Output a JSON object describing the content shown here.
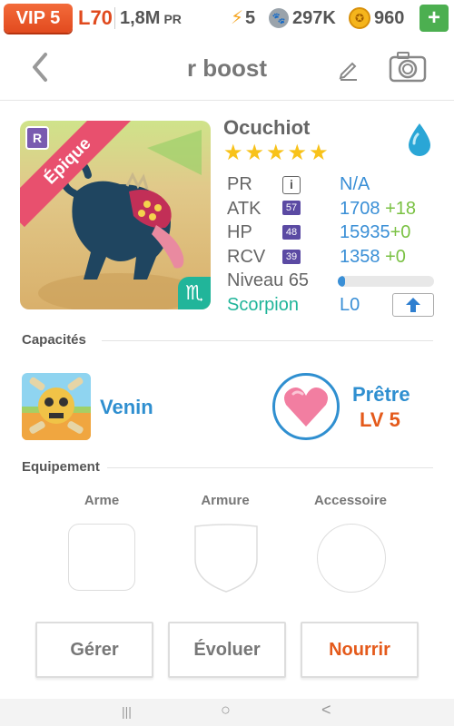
{
  "topbar": {
    "vip": "VIP 5",
    "level": "L70",
    "power": "1,8M",
    "power_unit": "PR",
    "energy": "5",
    "paws": "297K",
    "coins": "960",
    "add": "+"
  },
  "header": {
    "title": "r boost",
    "icons": [
      "back-arrow-icon",
      "edit-pencil-icon",
      "camera-icon"
    ]
  },
  "monster": {
    "rarity": "Épique",
    "rank_badge": "R",
    "name": "Ocuchiot",
    "stars": "★★★★★",
    "element": "water",
    "stats": [
      {
        "label": "PR",
        "badge": "i",
        "value": "N/A",
        "plus": ""
      },
      {
        "label": "ATK",
        "badge": "57",
        "value": "1708",
        "plus": "+18"
      },
      {
        "label": "HP",
        "badge": "48",
        "value": "15935",
        "plus": "+0"
      },
      {
        "label": "RCV",
        "badge": "39",
        "value": "1358",
        "plus": "+0"
      }
    ],
    "level_label": "Niveau 65",
    "level_progress": 0.08,
    "zodiac": "Scorpion",
    "zodiac_level": "L0",
    "zodiac_symbol": "♏"
  },
  "abilities": {
    "section": "Capacités",
    "skill": "Venin",
    "class_name": "Prêtre",
    "class_level": "LV 5"
  },
  "equipment": {
    "section": "Equipement",
    "slots": [
      "Arme",
      "Armure",
      "Accessoire"
    ]
  },
  "actions": {
    "manage": "Gérer",
    "evolve": "Évoluer",
    "feed": "Nourrir"
  },
  "navbar": {
    "recent": "|||",
    "home": "○",
    "back": "<"
  },
  "colors": {
    "accent": "#3a8fd6",
    "green": "#7ac143",
    "orange": "#e45a1b",
    "epic": "#e8506e",
    "zodiac": "#21b59a"
  }
}
